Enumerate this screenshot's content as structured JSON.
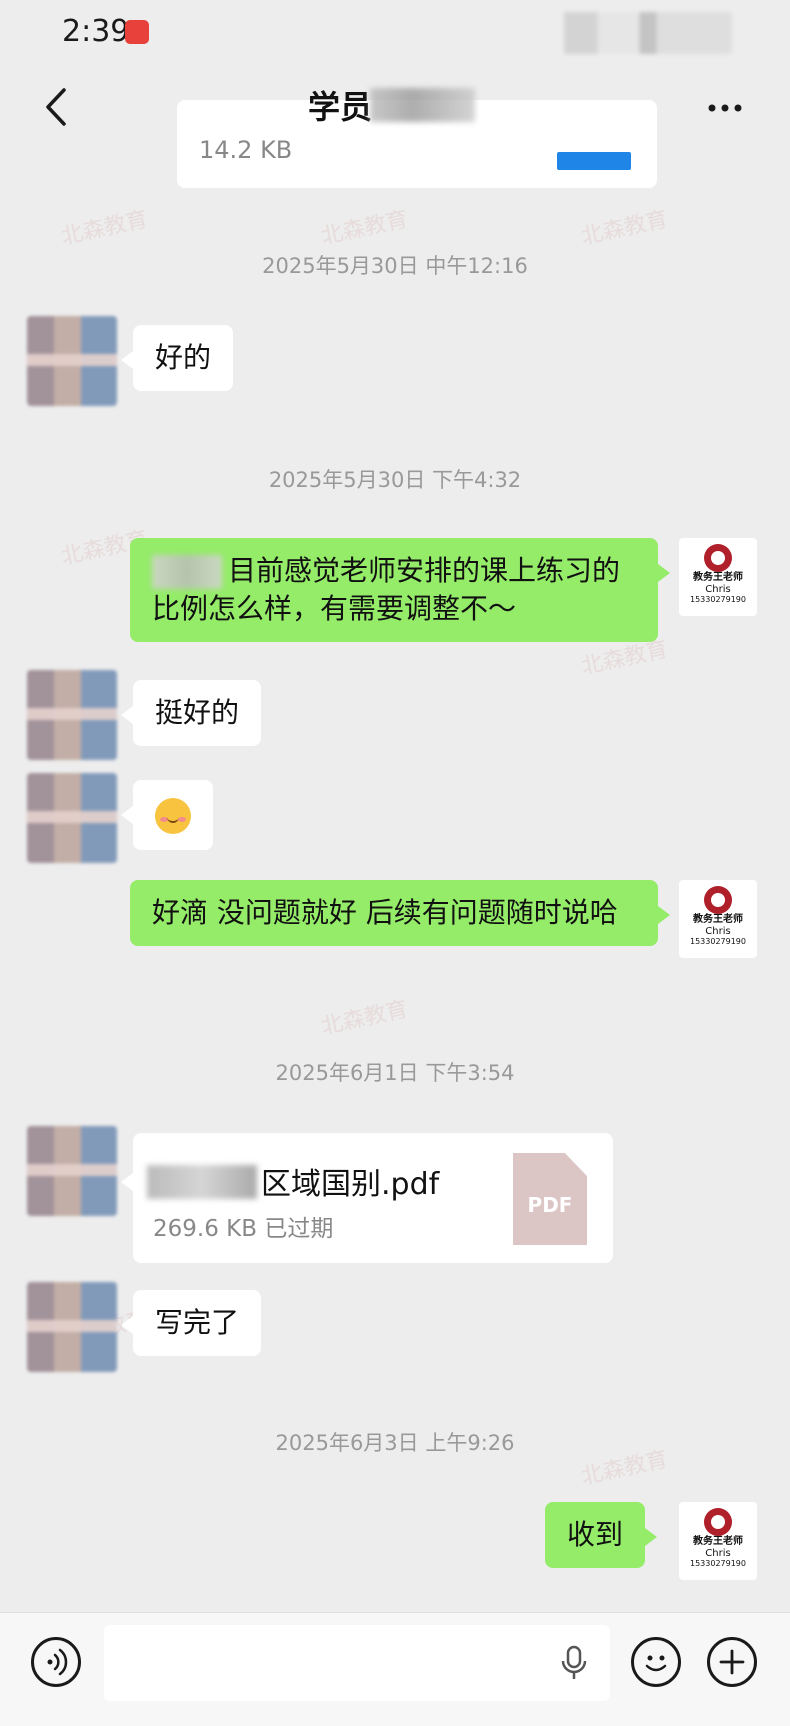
{
  "status_bar": {
    "time": "2:39"
  },
  "nav": {
    "title": "学员"
  },
  "previous_file": {
    "size": "14.2 KB"
  },
  "messages": {
    "ts1": "2025年5月30日 中午12:16",
    "m1": "好的",
    "ts2": "2025年5月30日 下午4:32",
    "m2": "目前感觉老师安排的课上练习的比例怎么样，有需要调整不～",
    "m3": "挺好的",
    "m5": "好滴  没问题就好  后续有问题随时说哈",
    "ts3": "2025年6月1日 下午3:54",
    "file_name": "区域国别.pdf",
    "file_meta": "269.6 KB  已过期",
    "file_icon_label": "PDF",
    "m7": "写完了",
    "ts4": "2025年6月3日 上午9:26",
    "m8": "收到"
  },
  "self_avatar": {
    "name": "教务王老师",
    "english_name": "Chris",
    "phone": "15330279190"
  },
  "icons": {
    "back": "chevron-left-icon",
    "more": "more-dots-icon",
    "voice": "voice-icon",
    "mic": "microphone-icon",
    "emoji": "smiley-icon",
    "plus": "plus-icon"
  },
  "colors": {
    "background": "#ededed",
    "bubble_out": "#95ec69",
    "bubble_in": "#ffffff",
    "timestamp": "#999999"
  }
}
